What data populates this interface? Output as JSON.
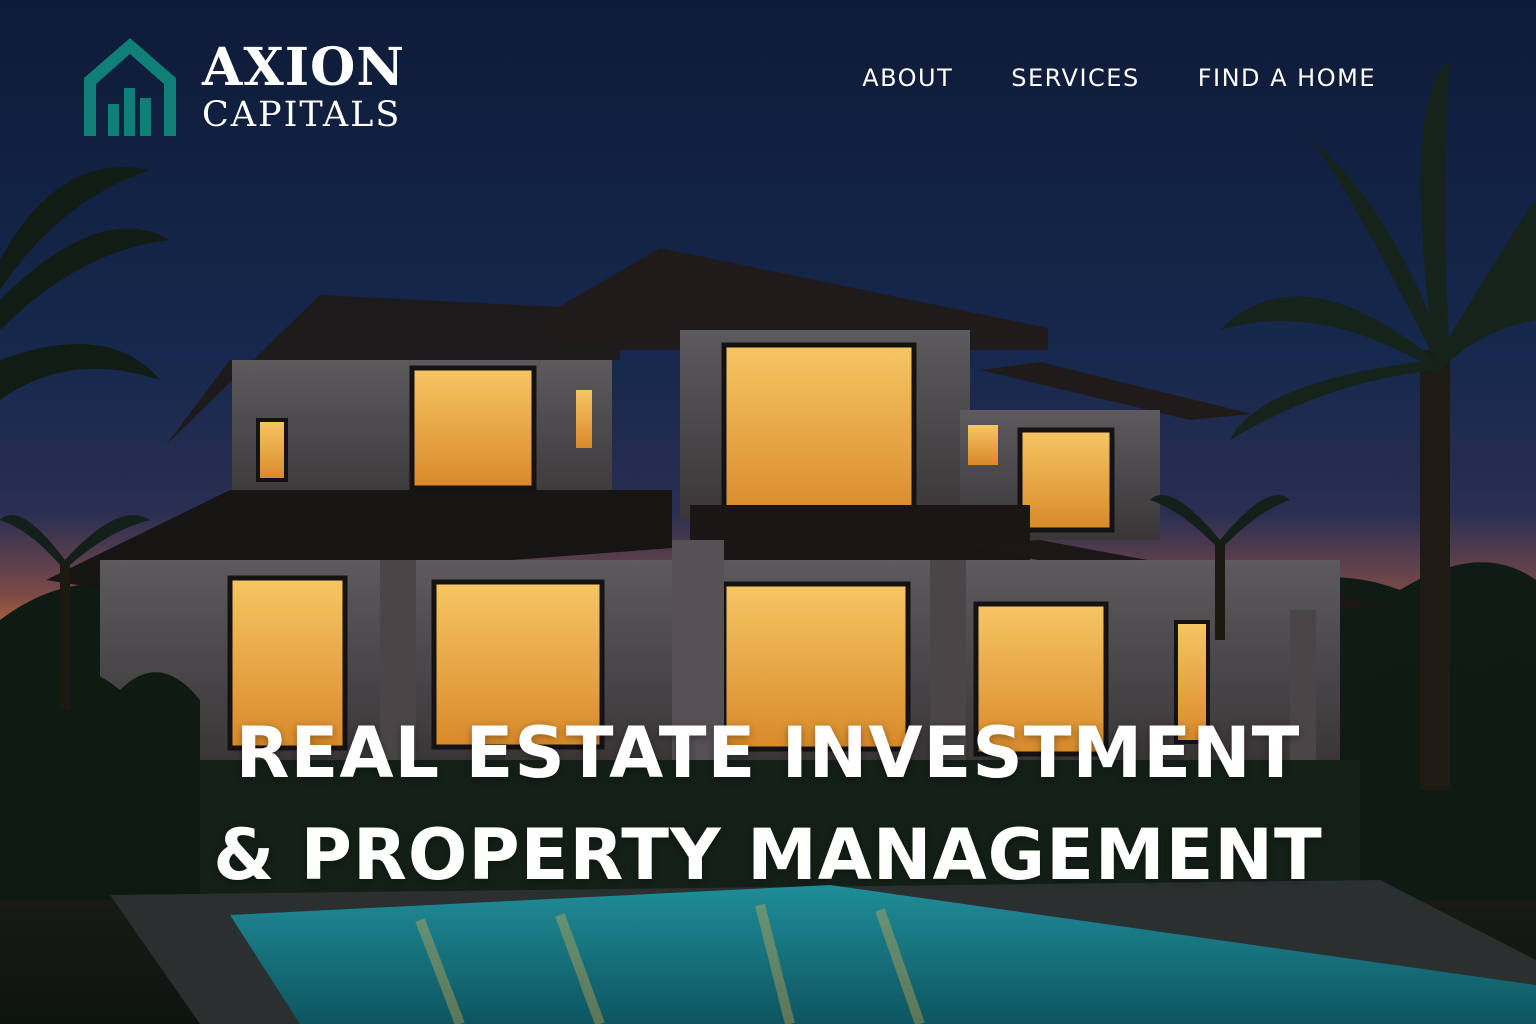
{
  "brand": {
    "name_line1": "AXION",
    "name_line2": "CAPITALS",
    "logo_icon": "house-bars-icon",
    "logo_color": "#0f7f78"
  },
  "nav": {
    "items": [
      {
        "label": "ABOUT"
      },
      {
        "label": "SERVICES"
      },
      {
        "label": "FIND A HOME"
      }
    ]
  },
  "hero": {
    "headline_line1": "REAL ESTATE INVESTMENT",
    "headline_line2": "& PROPERTY MANAGEMENT",
    "image_subject": "modern-two-story-house-at-dusk-with-pool-and-palms"
  },
  "colors": {
    "sky_top": "#0f1e3d",
    "horizon_glow": "#d97a2a",
    "window_light": "#f2b34a",
    "pool": "#2fb7c4"
  }
}
